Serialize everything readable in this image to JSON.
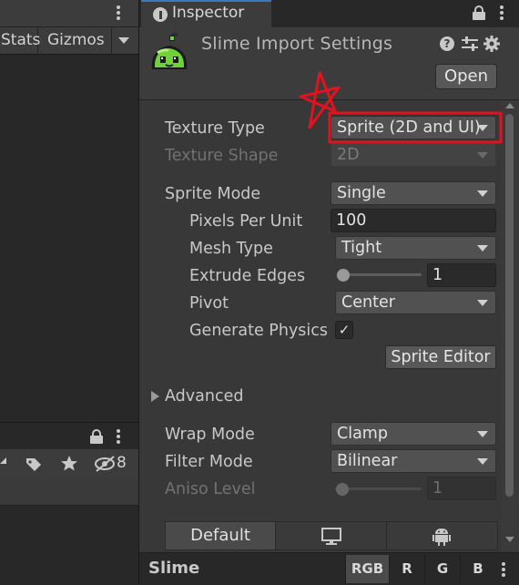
{
  "scene_toolbar": {
    "stats_label": "Stats",
    "gizmos_label": "Gizmos"
  },
  "bottom_left_toolbar": {
    "hidden_count": "8"
  },
  "inspector": {
    "tab_label": "Inspector",
    "title": "Slime Import Settings",
    "open_label": "Open",
    "help_glyph": "?"
  },
  "properties": {
    "texture_type": {
      "label": "Texture Type",
      "value": "Sprite (2D and UI)"
    },
    "texture_shape": {
      "label": "Texture Shape",
      "value": "2D"
    },
    "sprite_mode": {
      "label": "Sprite Mode",
      "value": "Single"
    },
    "pixels_per_unit": {
      "label": "Pixels Per Unit",
      "value": "100"
    },
    "mesh_type": {
      "label": "Mesh Type",
      "value": "Tight"
    },
    "extrude_edges": {
      "label": "Extrude Edges",
      "value": "1"
    },
    "pivot": {
      "label": "Pivot",
      "value": "Center"
    },
    "generate_physics": {
      "label": "Generate Physics",
      "checked": true,
      "check_glyph": "✓"
    },
    "sprite_editor_label": "Sprite Editor",
    "advanced_label": "Advanced",
    "wrap_mode": {
      "label": "Wrap Mode",
      "value": "Clamp"
    },
    "filter_mode": {
      "label": "Filter Mode",
      "value": "Bilinear"
    },
    "aniso_level": {
      "label": "Aniso Level",
      "value": "1"
    }
  },
  "platform_tabs": {
    "default_label": "Default"
  },
  "preview": {
    "title": "Slime",
    "channels": [
      "RGB",
      "R",
      "G",
      "B"
    ]
  },
  "colors": {
    "accent_blue": "#3a79bb",
    "annotation_red": "#e0141e",
    "slime_green": "#6fd23a"
  },
  "icons": [
    "info-icon",
    "lock-icon",
    "kebab-menu-icon",
    "help-icon",
    "presets-icon",
    "settings-gear-icon",
    "tag-icon",
    "star-icon",
    "hidden-eye-icon",
    "monitor-icon",
    "android-icon",
    "slime-asset-icon"
  ]
}
